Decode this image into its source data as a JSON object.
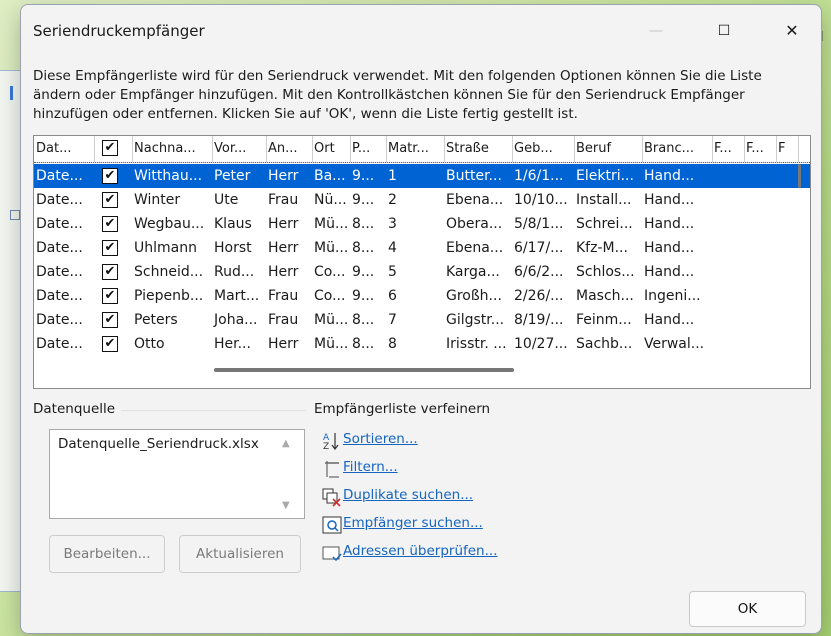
{
  "background": {
    "partial_text": "l"
  },
  "dialog": {
    "title": "Seriendruckempfänger",
    "controls": {
      "minimize": "—",
      "maximize": "☐",
      "close": "✕"
    },
    "description": "Diese Empfängerliste wird für den Seriendruck verwendet. Mit den folgenden Optionen können Sie die Liste ändern oder Empfänger hinzufügen. Mit den Kontrollkästchen können Sie für den Seriendruck Empfänger hinzufügen oder entfernen. Klicken Sie auf 'OK', wenn die Liste fertig gestellt ist."
  },
  "table": {
    "headers": [
      "Dat...",
      "",
      "Nachna...",
      "Vor...",
      "An...",
      "Ort",
      "P...",
      "Matr...",
      "Straße",
      "Geb...",
      "Beruf",
      "Branc...",
      "F...",
      "F...",
      "F"
    ],
    "rows": [
      [
        "Date...",
        "✔",
        "Witthau...",
        "Peter",
        "Herr",
        "Ba...",
        "9...",
        "1",
        "Butter...",
        "1/6/1...",
        "Elektri...",
        "Hand..."
      ],
      [
        "Date...",
        "✔",
        "Winter",
        "Ute",
        "Frau",
        "Nü...",
        "9...",
        "2",
        "Ebena...",
        "10/10...",
        "Install...",
        "Hand..."
      ],
      [
        "Date...",
        "✔",
        "Wegbau...",
        "Klaus",
        "Herr",
        "Mü...",
        "8...",
        "3",
        "Obera...",
        "5/8/1...",
        "Schrei...",
        "Hand..."
      ],
      [
        "Date...",
        "✔",
        "Uhlmann",
        "Horst",
        "Herr",
        "Mü...",
        "8...",
        "4",
        "Ebena...",
        "6/17/...",
        "Kfz-M...",
        "Hand..."
      ],
      [
        "Date...",
        "✔",
        "Schneid...",
        "Rud...",
        "Herr",
        "Co...",
        "9...",
        "5",
        "Karga...",
        "6/6/2...",
        "Schlos...",
        "Hand..."
      ],
      [
        "Date...",
        "✔",
        "Piepenb...",
        "Mart...",
        "Frau",
        "Co...",
        "9...",
        "6",
        "Großh...",
        "2/26/...",
        "Masch...",
        "Ingeni..."
      ],
      [
        "Date...",
        "✔",
        "Peters",
        "Joha...",
        "Frau",
        "Mü...",
        "8...",
        "7",
        "Gilgstr...",
        "8/19/...",
        "Feinm...",
        "Hand..."
      ],
      [
        "Date...",
        "✔",
        "Otto",
        "Her...",
        "Herr",
        "Mü...",
        "8...",
        "8",
        "Irisstr. ...",
        "10/27...",
        "Sachb...",
        "Verwal..."
      ]
    ],
    "header_checkbox": "✔",
    "selected_row": 0
  },
  "datasource": {
    "label": "Datenquelle",
    "items": [
      "Datenquelle_Seriendruck.xlsx"
    ],
    "edit_button": "Bearbeiten...",
    "refresh_button": "Aktualisieren"
  },
  "refine": {
    "label": "Empfängerliste verfeinern",
    "links": [
      {
        "icon": "sort-az-icon",
        "label": "Sortieren..."
      },
      {
        "icon": "filter-icon",
        "label": "Filtern..."
      },
      {
        "icon": "duplicates-icon",
        "label": "Duplikate suchen..."
      },
      {
        "icon": "find-recipient-icon",
        "label": "Empfänger suchen..."
      },
      {
        "icon": "validate-addresses-icon",
        "label": "Adressen überprüfen..."
      }
    ]
  },
  "ok_button": "OK",
  "colors": {
    "selection": "#0063d3",
    "link": "#1565c0"
  }
}
